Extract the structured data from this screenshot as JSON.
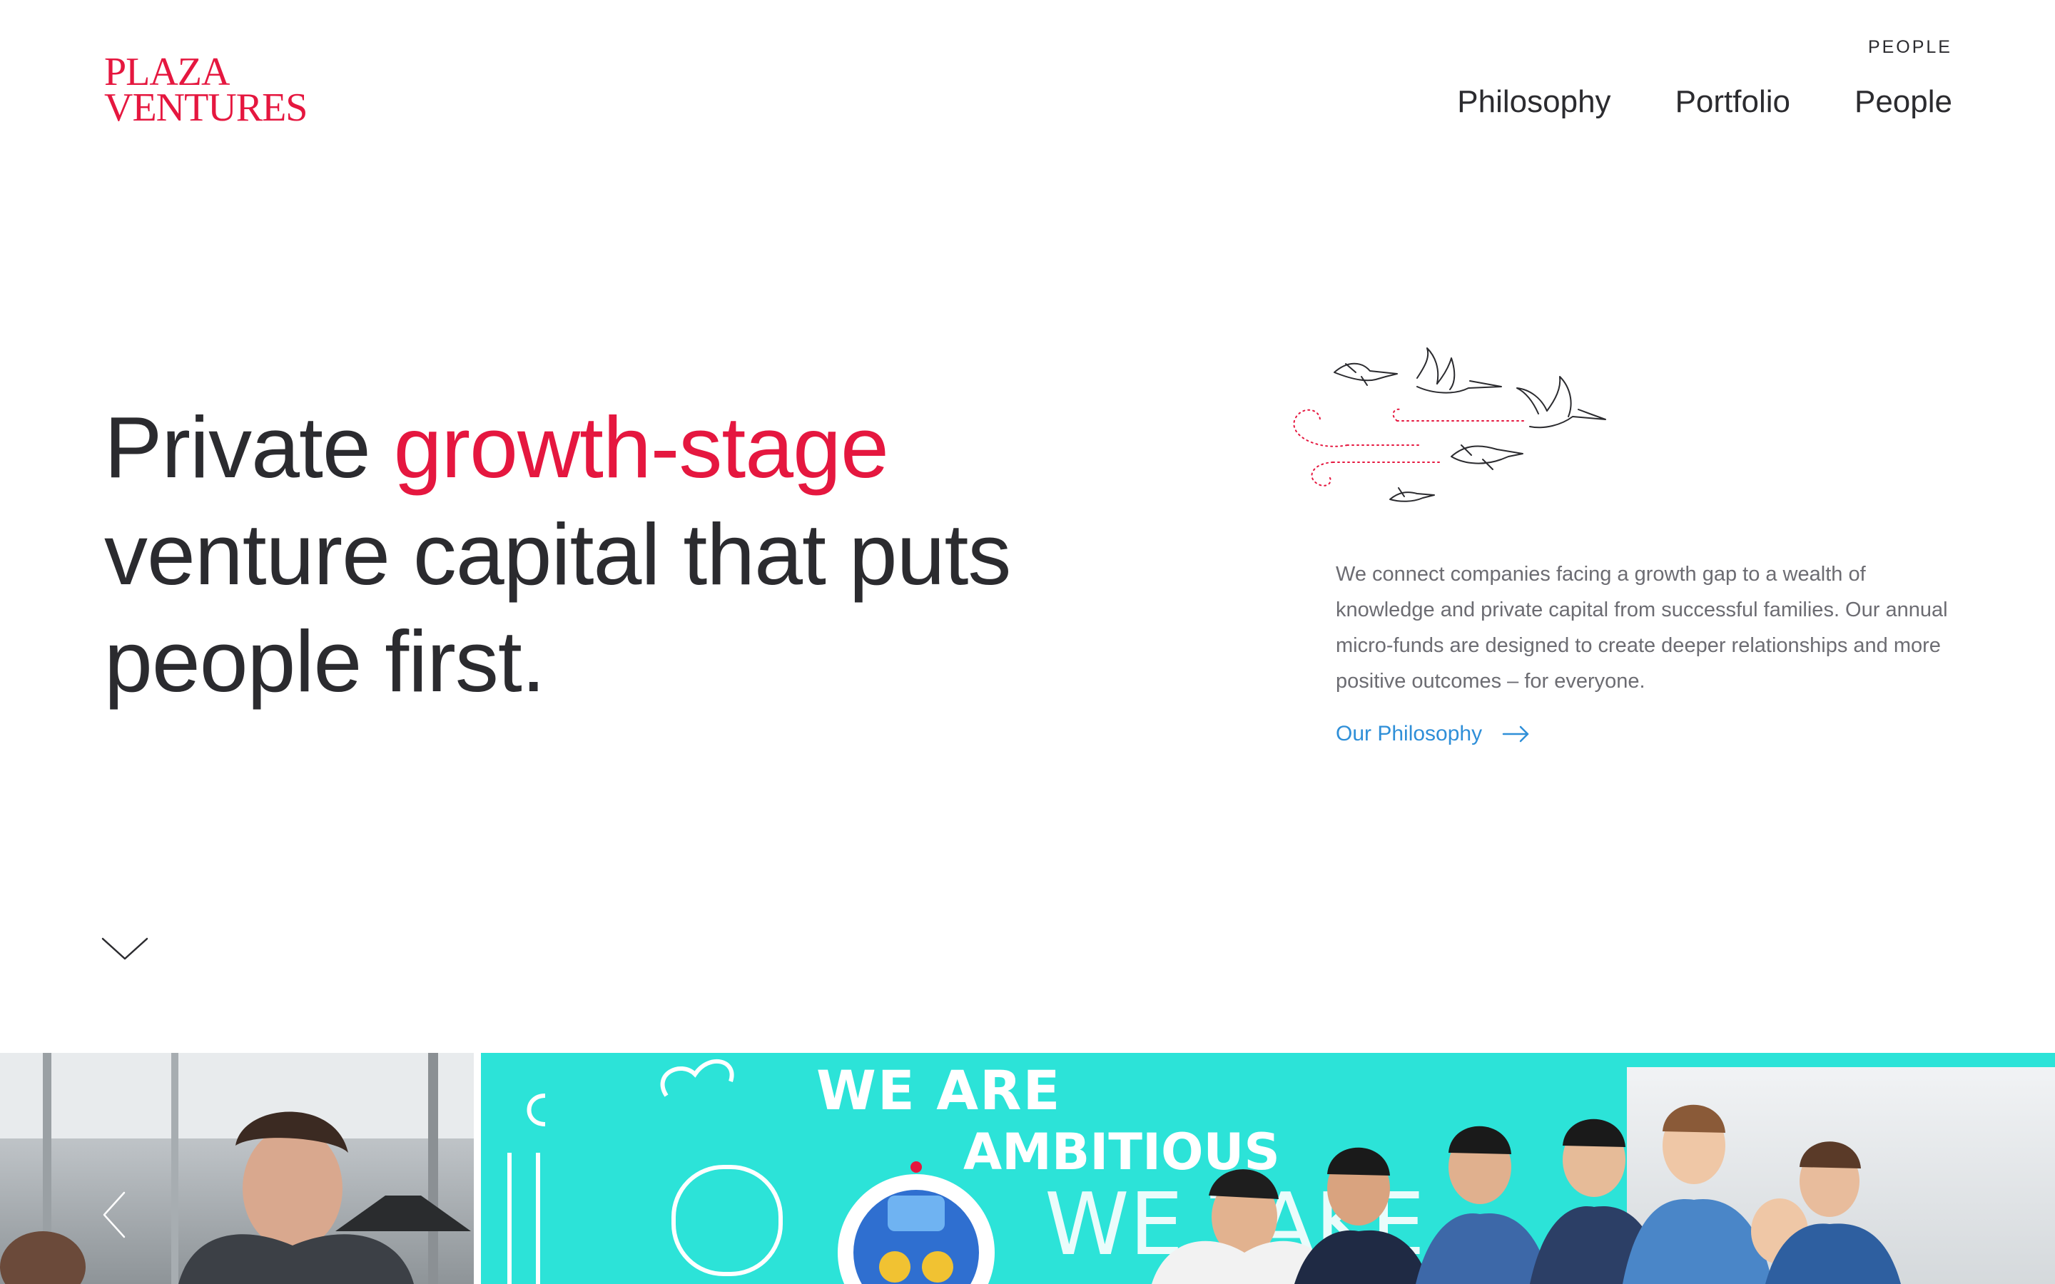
{
  "header": {
    "logo_line1": "PLAZA",
    "logo_line2": "VENTURES",
    "top_label": "PEOPLE",
    "nav": [
      "Philosophy",
      "Portfolio",
      "People"
    ]
  },
  "hero": {
    "headline_start": "Private ",
    "headline_accent": "growth-stage",
    "headline_line2": "venture capital that puts",
    "headline_line3": "people first.",
    "intro": "We connect companies facing a growth gap to a wealth of knowledge and private capital from successful families. Our annual micro-funds are designed to create deeper relationships and more positive outcomes – for everyone.",
    "link_label": "Our Philosophy"
  },
  "photos": {
    "mural_line1": "WE ARE",
    "mural_line2": "AMBITIOUS",
    "mural_line3": "WE TAKE"
  },
  "colors": {
    "brand_red": "#e5173f",
    "link_blue": "#2f8fd8",
    "text_dark": "#2b2b2f",
    "text_muted": "#6c6c72",
    "mural_teal": "#2ce3d8"
  },
  "icons": {
    "illustration": "flying-birds-icon",
    "link_arrow": "arrow-right-icon",
    "scroll": "chevron-down-icon",
    "carousel": "chevron-left-icon"
  }
}
